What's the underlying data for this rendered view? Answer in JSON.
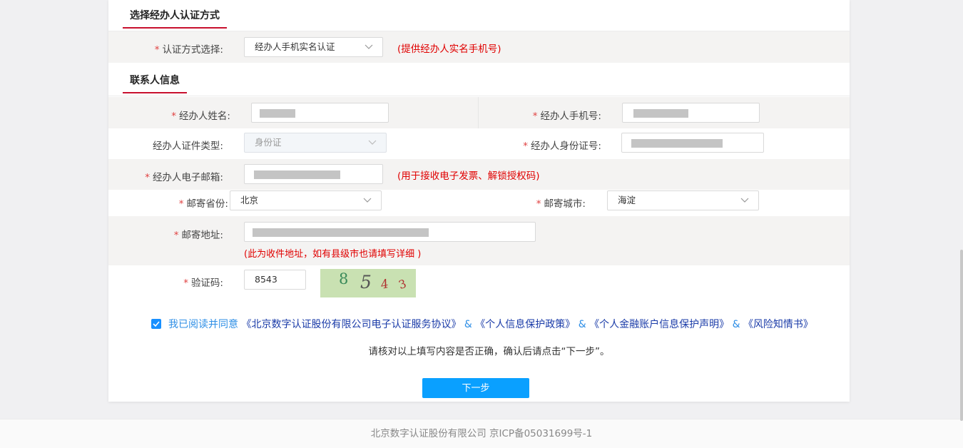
{
  "section_auth": {
    "title": "选择经办人认证方式"
  },
  "auth_method": {
    "label": "认证方式选择:",
    "value": "经办人手机实名认证",
    "hint": "(提供经办人实名手机号)"
  },
  "section_contact": {
    "title": "联系人信息"
  },
  "form": {
    "name": {
      "label": "经办人姓名:"
    },
    "phone": {
      "label": "经办人手机号:"
    },
    "id_type": {
      "label": "经办人证件类型:",
      "value": "身份证"
    },
    "id_number": {
      "label": "经办人身份证号:"
    },
    "email": {
      "label": "经办人电子邮箱:",
      "hint": "(用于接收电子发票、解锁授权码)"
    },
    "province": {
      "label": "邮寄省份:",
      "value": "北京"
    },
    "city": {
      "label": "邮寄城市:",
      "value": "海淀"
    },
    "address": {
      "label": "邮寄地址:",
      "hint": "(此为收件地址，如有县级市也请填写详细 )"
    },
    "captcha": {
      "label": "验证码:",
      "value": "8543",
      "chars": [
        "8",
        "5",
        "4",
        "3"
      ]
    }
  },
  "required_mark": "*",
  "agreement": {
    "checked": true,
    "prefix": "我已阅读并同意",
    "links": [
      "《北京数字认证股份有限公司电子认证服务协议》",
      "《个人信息保护政策》",
      "《个人金融账户信息保护声明》",
      "《风险知情书》"
    ],
    "separator": "&"
  },
  "notice": "请核对以上填写内容是否正确，确认后请点击“下一步”。",
  "next_button": "下一步",
  "footer": "北京数字认证股份有限公司 京ICP备05031699号-1",
  "colors": {
    "accent_red": "#c8102e",
    "hint_red": "#e00000",
    "button_blue": "#0aa0ff",
    "link_blue": "#1a3ba8"
  }
}
